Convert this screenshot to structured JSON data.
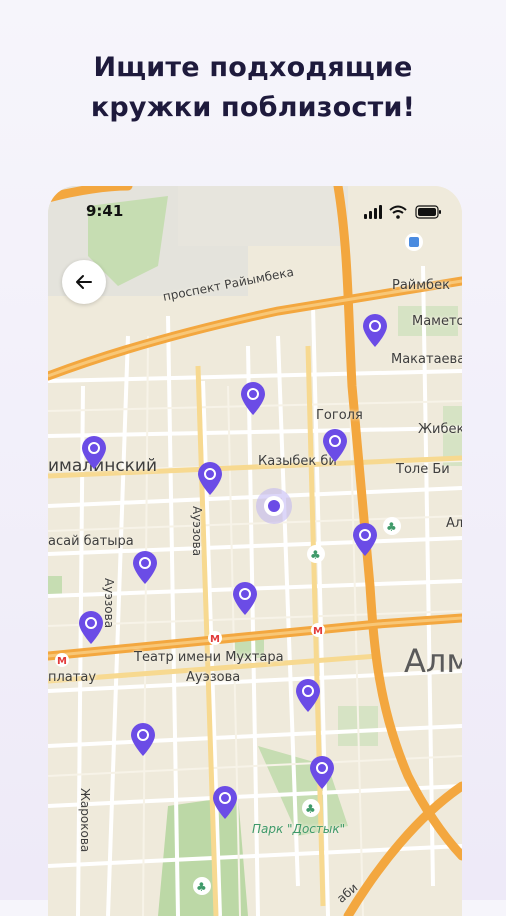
{
  "headline": {
    "line1": "Ищите подходящие",
    "line2": "кружки поблизости!"
  },
  "status_bar": {
    "time": "9:41"
  },
  "map": {
    "labels": {
      "raiymbek_avenue": "проспект Райымбека",
      "raiymbek_right": "Раймбек",
      "mametova": "Маметов",
      "makataeva": "Макатаева",
      "gogolya": "Гоголя",
      "kazybek_bi": "Казыбек би",
      "zhibek": "Жибек",
      "tole_bi": "Толе Би",
      "almalinsky": "ималинский",
      "kalkanova": "Ауэзова",
      "naurai_batyra": "асай батыра",
      "auezova_vertical": "Ауэзова",
      "theatre": "Театр имени Мухтара",
      "auezova_below": "Ауэзова",
      "abylai": "платау",
      "alma": "Алм",
      "al": "Ал",
      "zharokova": "Жарокова",
      "park_dostyk": "Парк \"Достык\"",
      "bottom_right": "аби"
    },
    "pin_count": 14,
    "colors": {
      "pin": "#6b4ce6",
      "main_road": "#f3a73f",
      "background": "#efeadb",
      "park": "#bcd8a6"
    }
  }
}
